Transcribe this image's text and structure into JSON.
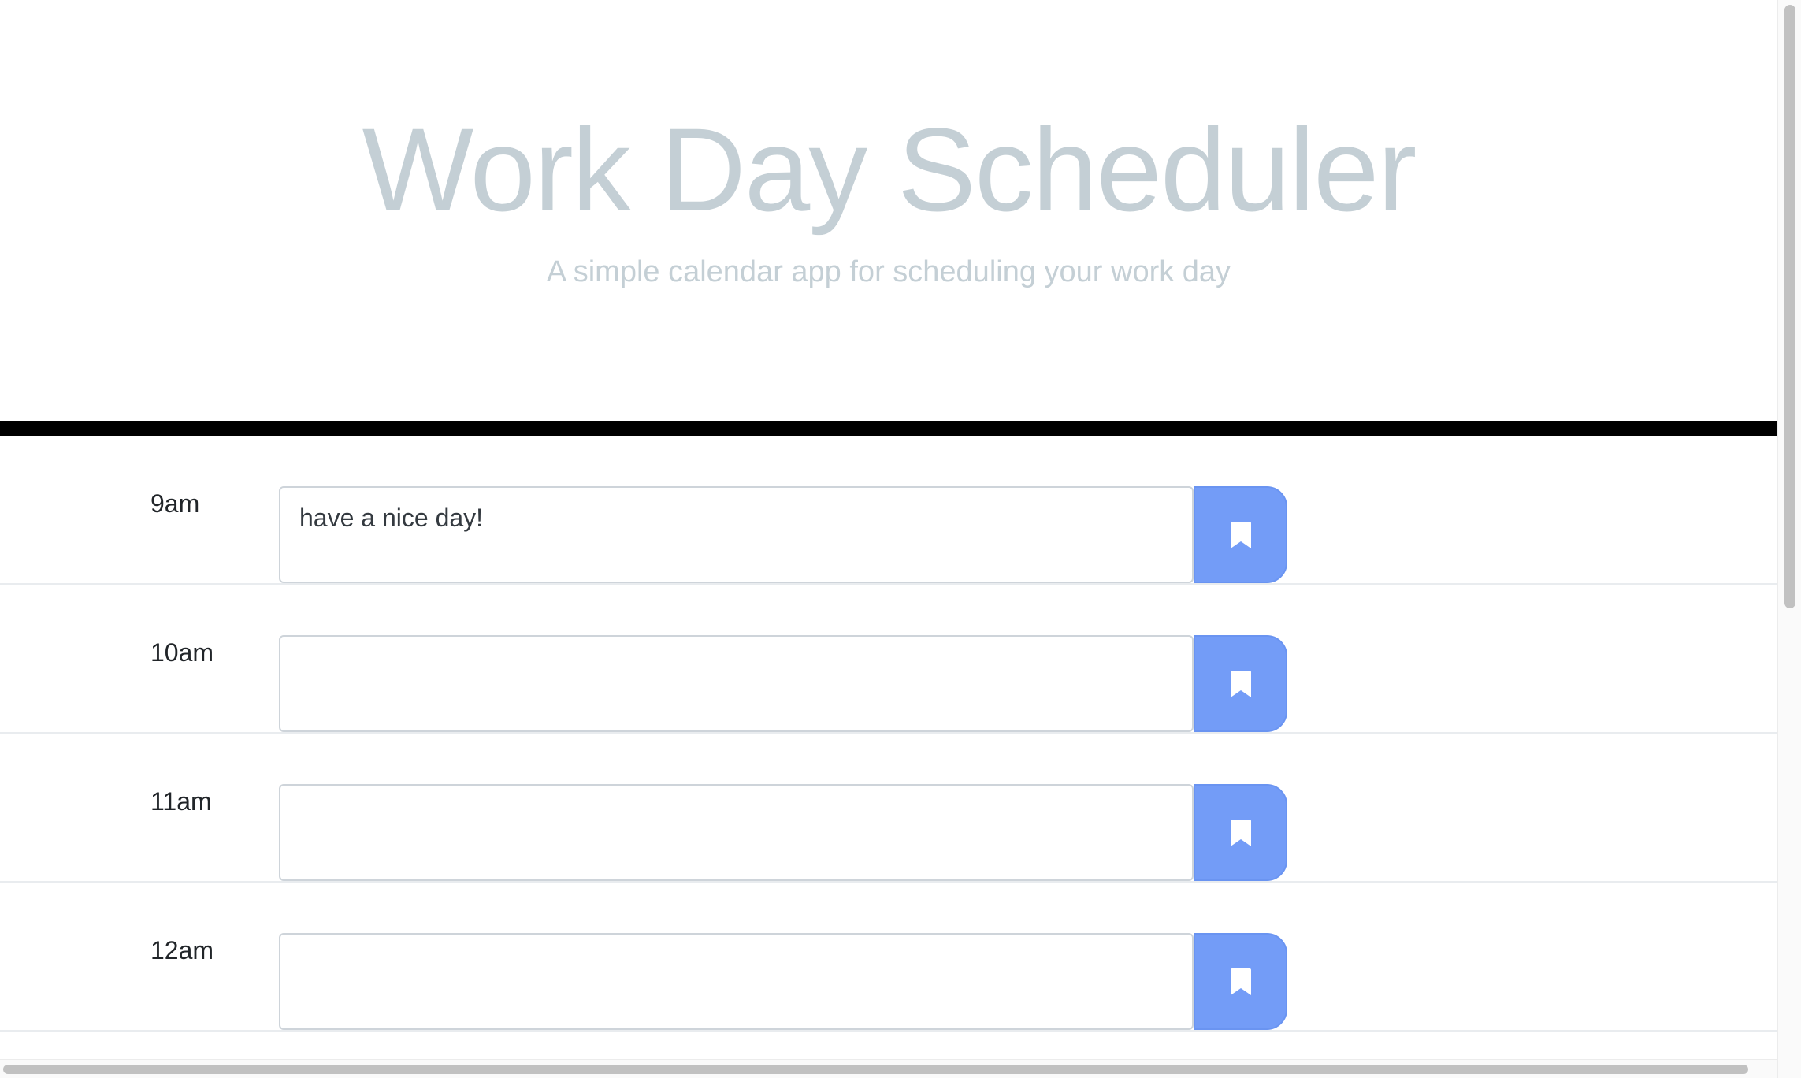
{
  "header": {
    "title": "Work Day Scheduler",
    "subtitle": "A simple calendar app for scheduling your work day"
  },
  "hours": [
    {
      "label": "9am",
      "description": "have a nice day!"
    },
    {
      "label": "10am",
      "description": ""
    },
    {
      "label": "11am",
      "description": ""
    },
    {
      "label": "12am",
      "description": ""
    }
  ],
  "save_button": {
    "icon": "bookmark-icon"
  },
  "colors": {
    "title": "#c4cfd5",
    "divider": "#000000",
    "save_button": "#739cf7"
  }
}
